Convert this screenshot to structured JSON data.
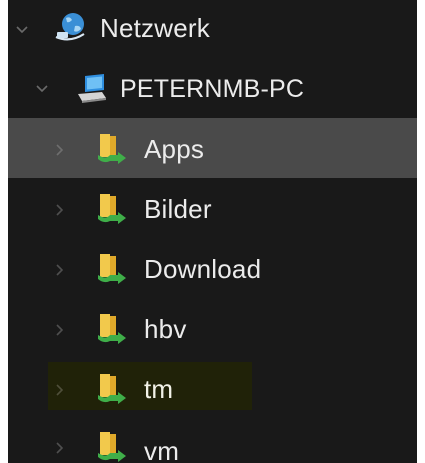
{
  "tree": {
    "network": {
      "label": "Netzwerk",
      "icon": "network-globe-icon",
      "expanded": true
    },
    "computer": {
      "label": "PETERNMB-PC",
      "icon": "computer-icon",
      "expanded": true
    },
    "shares": [
      {
        "label": "Apps",
        "icon": "shared-folder-icon",
        "state": "selected"
      },
      {
        "label": "Bilder",
        "icon": "shared-folder-icon",
        "state": "normal"
      },
      {
        "label": "Download",
        "icon": "shared-folder-icon",
        "state": "normal"
      },
      {
        "label": "hbv",
        "icon": "shared-folder-icon",
        "state": "normal"
      },
      {
        "label": "tm",
        "icon": "shared-folder-icon",
        "state": "highlighted"
      },
      {
        "label": "vm",
        "icon": "shared-folder-icon",
        "state": "normal"
      }
    ]
  },
  "colors": {
    "background": "#191919",
    "selected": "#4a4a4a",
    "highlight": "#202208",
    "text": "#ececec",
    "folder": "#f2c94c",
    "share_arrow": "#3fae49",
    "globe": "#3a8fd6"
  }
}
